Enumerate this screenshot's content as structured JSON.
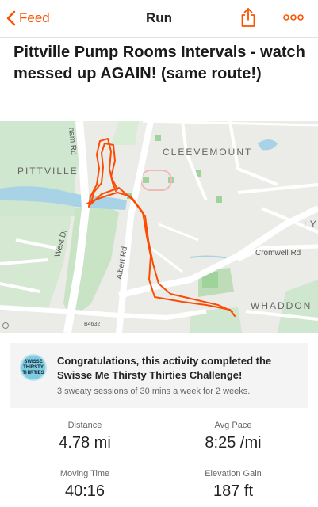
{
  "nav": {
    "back_label": "Feed",
    "title": "Run"
  },
  "activity": {
    "title": "Pittville Pump Rooms Intervals - watch messed up AGAIN! (same route!)"
  },
  "map": {
    "labels": {
      "cleevemount": "CLEEVEMOUNT",
      "pittville": "PITTVILLE",
      "whaddon": "WHADDON",
      "ly": "LY",
      "cromwell_rd": "Cromwell Rd",
      "albert_rd": "Albert Rd",
      "west_dr": "West Dr",
      "ham_rd": "ham Rd",
      "b4632": "B4632"
    },
    "route_color": "#fc4c02"
  },
  "challenge": {
    "badge_lines": [
      "SWISSE",
      "THIRSTY",
      "THIRTIES"
    ],
    "title": "Congratulations, this activity completed the Swisse Me Thirsty Thirties Challenge!",
    "subtitle": "3 sweaty sessions of 30 mins a week for 2 weeks."
  },
  "stats": {
    "distance": {
      "label": "Distance",
      "value": "4.78 mi"
    },
    "avg_pace": {
      "label": "Avg Pace",
      "value": "8:25 /mi"
    },
    "moving_time": {
      "label": "Moving Time",
      "value": "40:16"
    },
    "elevation_gain": {
      "label": "Elevation Gain",
      "value": "187 ft"
    }
  },
  "colors": {
    "accent": "#fc5200"
  }
}
